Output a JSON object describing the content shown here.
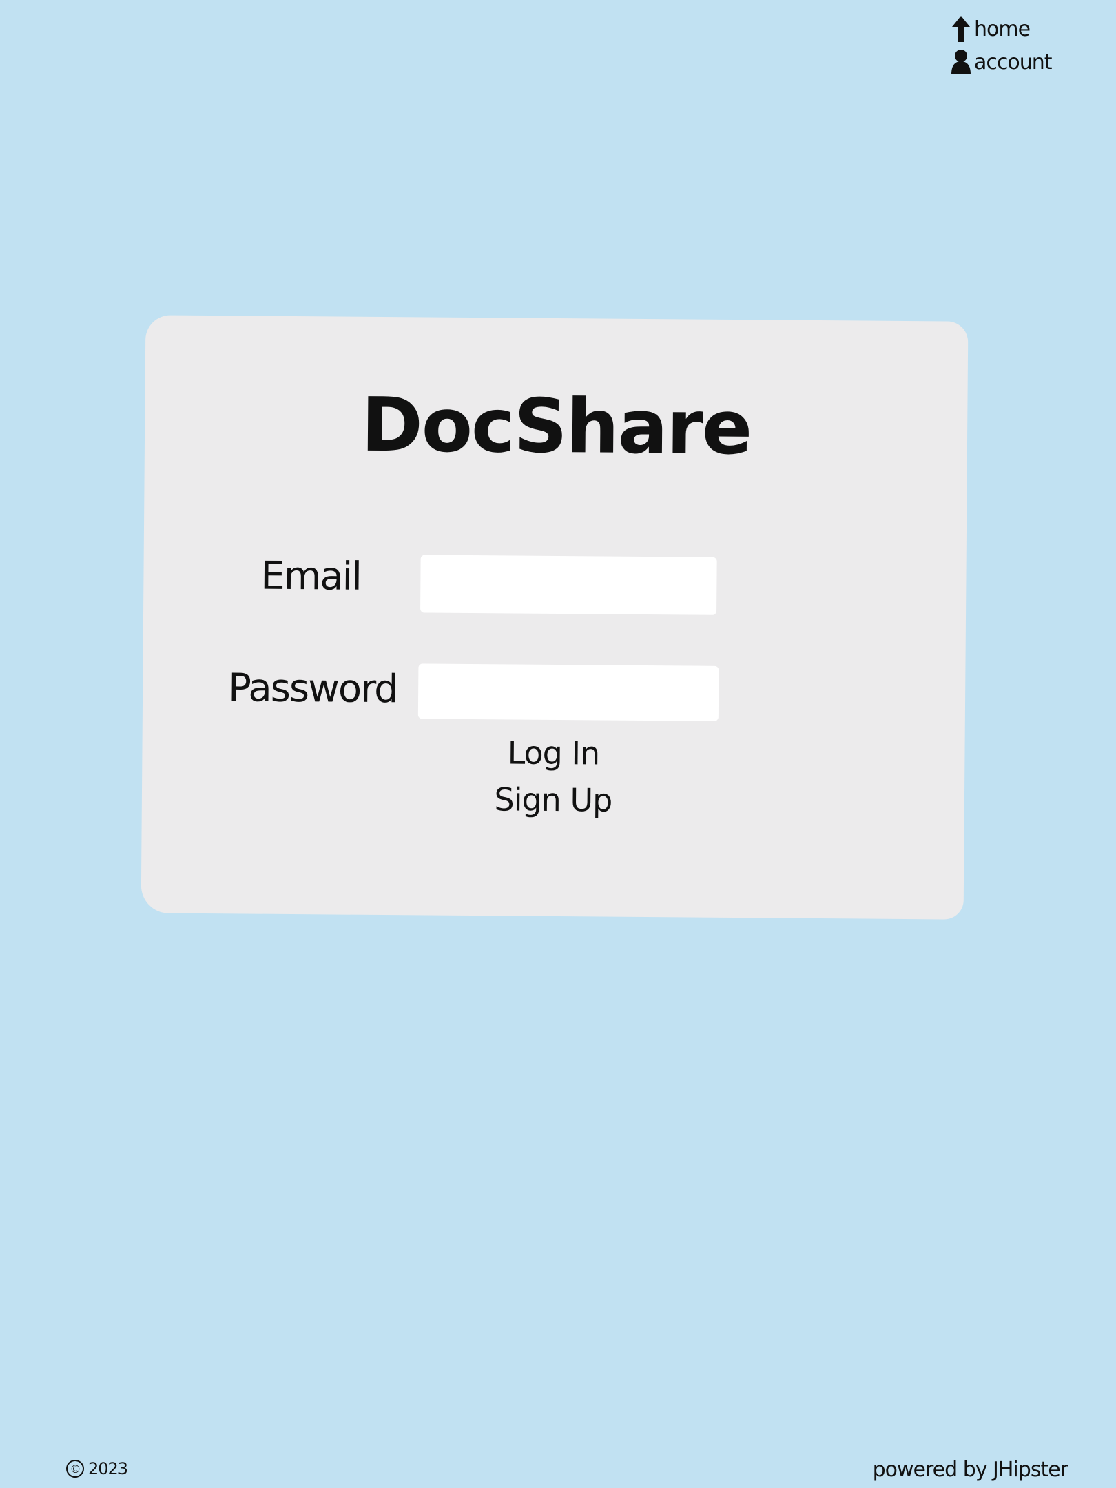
{
  "nav": {
    "home": {
      "label": "home",
      "icon": "up-arrow-icon"
    },
    "account": {
      "label": "account",
      "icon": "user-icon"
    }
  },
  "login": {
    "title": "DocShare",
    "email_label": "Email",
    "email_value": "",
    "password_label": "Password",
    "password_value": "",
    "login_label": "Log In",
    "signup_label": "Sign Up"
  },
  "footer": {
    "copyright_symbol": "©",
    "year": "2023",
    "powered_by": "powered by JHipster"
  },
  "colors": {
    "background": "#c1e1f2",
    "card": "#ecebec",
    "input": "#ffffff",
    "text": "#111111"
  }
}
